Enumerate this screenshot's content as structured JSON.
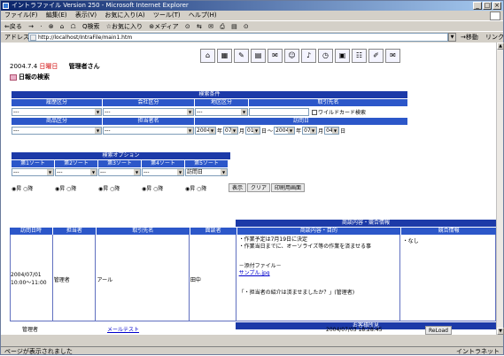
{
  "window": {
    "title": "イントラファイル Version 250 - Microsoft Internet Explorer",
    "menu": [
      "ファイル(F)",
      "編集(E)",
      "表示(V)",
      "お気に入り(A)",
      "ツール(T)",
      "ヘルプ(H)"
    ],
    "toolbar": [
      "⇐戻る",
      "→",
      "·",
      "⊗",
      "⌂",
      "☖",
      "Q検索",
      "☆お気に入り",
      "⊛メディア",
      "⊙",
      "⇆",
      "✉",
      "⎙",
      "▤",
      "⊙"
    ],
    "address_label": "アドレス(D)",
    "address_value": "http://localhost/IntraFile/main1.htm",
    "go_label": "→移動",
    "links_label": "リンク »",
    "status_text": "ページが表示されました",
    "zone_text": "イントラネット"
  },
  "header": {
    "date": "2004.7.4",
    "weekday": "日曜日",
    "user": "管理者さん",
    "page_title": "日報の検索",
    "icons": [
      "home-icon",
      "calendar-icon",
      "memo-icon",
      "file-icon",
      "mail-icon",
      "chat-icon",
      "note-icon",
      "schedule-icon",
      "report-icon",
      "group-icon",
      "tools-icon",
      "info-icon"
    ]
  },
  "search_conditions": {
    "title": "検索条件",
    "col1": [
      "履歴区分",
      "商品区分"
    ],
    "col2": [
      "会社区分",
      "担当者名"
    ],
    "col3": [
      "地区区分",
      "訪問日"
    ],
    "col4": "取引先名",
    "wildcard_label": "ワイルドカード検索",
    "select_default": "---",
    "date_from": {
      "year": "2004",
      "month": "07",
      "day": "01"
    },
    "date_to": {
      "year": "2004",
      "month": "07",
      "day": "04"
    },
    "year_unit": "年",
    "month_unit": "月",
    "day_unit": "日",
    "range_sep": "〜"
  },
  "search_options": {
    "title": "検索オプション",
    "sorts": [
      "第1ソート",
      "第2ソート",
      "第3ソート",
      "第4ソート",
      "第5ソート"
    ],
    "sort_values": [
      "---",
      "---",
      "---",
      "---",
      "訪問日"
    ],
    "asc": "昇",
    "desc": "降",
    "buttons": [
      "表示",
      "クリア",
      "印刷用画面"
    ]
  },
  "results": {
    "group_header": "商談内容・競合情報",
    "columns": [
      "訪問日時",
      "担当者",
      "取引先名",
      "面談者",
      "商談内容・目的",
      "競合情報"
    ],
    "rows": [
      {
        "datetime": "2004/07/01",
        "time": "10:00〜11:00",
        "staff": "管理者",
        "client": "アール",
        "contact": "田中",
        "detail_lines": [
          "・作業予定は7月19日に決定",
          "・作業当日までに、オーソライズ等の作業を済ませる事"
        ],
        "attach_label": "－添付ファイル－",
        "attach_file": "サンプル.jpg",
        "comment": "「・担当者の紹介は済ませましたか？」(管理者)",
        "competitor": "・なし"
      }
    ],
    "next_header": "お客様所見"
  },
  "footer": {
    "user": "管理者",
    "mail_link": "メールテスト",
    "timestamp": "2004/07/03 18:28:45",
    "reload": "ReLoad"
  }
}
